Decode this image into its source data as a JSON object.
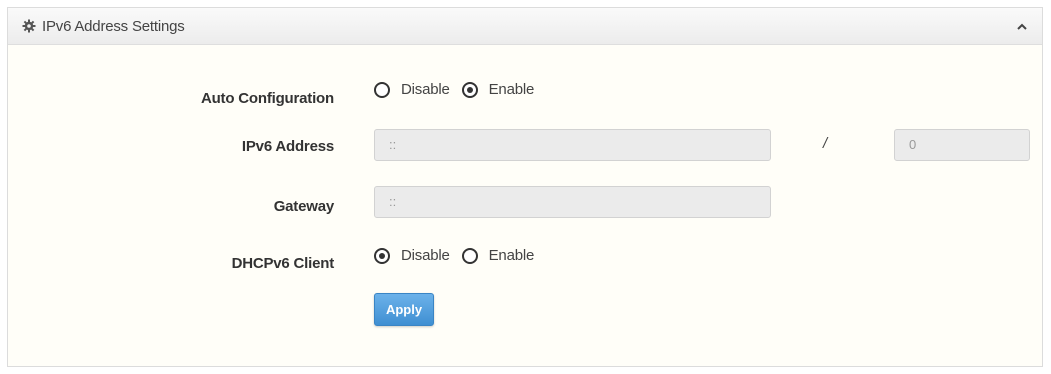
{
  "panel": {
    "title": "IPv6 Address Settings",
    "header_icon": "gear-icon",
    "collapse_icon": "chevron-up-icon"
  },
  "form": {
    "auto_configuration": {
      "label": "Auto Configuration",
      "options": [
        "Disable",
        "Enable"
      ],
      "selected": "Enable"
    },
    "ipv6_address": {
      "label": "IPv6 Address",
      "value": "::",
      "separator": "/",
      "prefix_length": "0"
    },
    "gateway": {
      "label": "Gateway",
      "value": "::"
    },
    "dhcpv6_client": {
      "label": "DHCPv6 Client",
      "options": [
        "Disable",
        "Enable"
      ],
      "selected": "Disable"
    },
    "apply_label": "Apply"
  },
  "colors": {
    "apply_button": "#4a9ce0",
    "input_background": "#ebebeb",
    "panel_background": "#fffef8"
  }
}
